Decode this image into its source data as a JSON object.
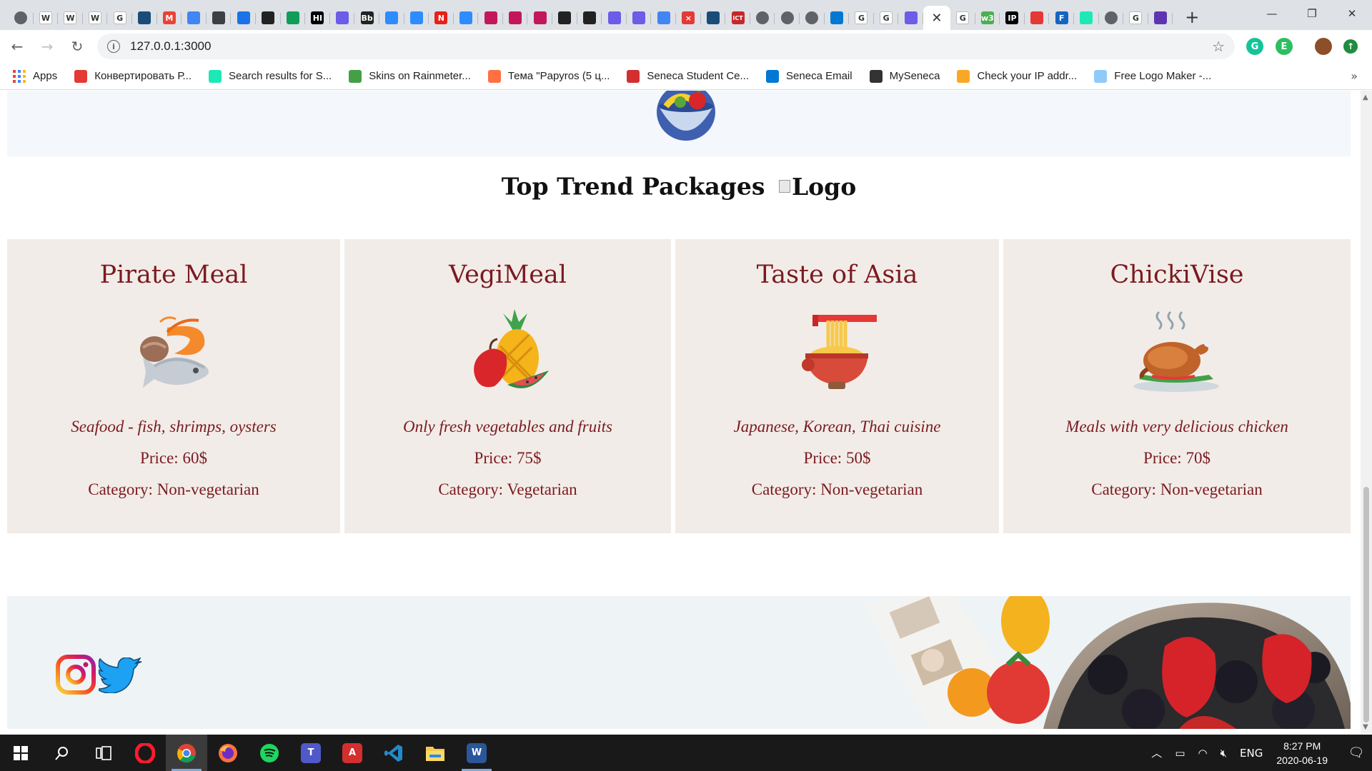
{
  "browser": {
    "tabs": [
      {
        "icon": "globe-icon",
        "color": "#5f6368",
        "glyph": ""
      },
      {
        "icon": "wikipedia-icon",
        "color": "#ffffff",
        "glyph": "W"
      },
      {
        "icon": "wikipedia-icon",
        "color": "#ffffff",
        "glyph": "W"
      },
      {
        "icon": "wikipedia-icon",
        "color": "#ffffff",
        "glyph": "W"
      },
      {
        "icon": "doc-icon",
        "color": "#ffffff",
        "glyph": "G"
      },
      {
        "icon": "bird-icon",
        "color": "#1a4c7a",
        "glyph": ""
      },
      {
        "icon": "gmail-icon",
        "color": "#ea4335",
        "glyph": "M"
      },
      {
        "icon": "translate-icon",
        "color": "#4285f4",
        "glyph": ""
      },
      {
        "icon": "image-icon",
        "color": "#3c4043",
        "glyph": ""
      },
      {
        "icon": "lines-icon",
        "color": "#1a73e8",
        "glyph": ""
      },
      {
        "icon": "qr-icon",
        "color": "#222222",
        "glyph": ""
      },
      {
        "icon": "arrow-icon",
        "color": "#0f9d58",
        "glyph": ""
      },
      {
        "icon": "hi-icon",
        "color": "#000000",
        "glyph": "HI"
      },
      {
        "icon": "wave-icon",
        "color": "#6c5ce7",
        "glyph": ""
      },
      {
        "icon": "bb-icon",
        "color": "#222222",
        "glyph": "Bb"
      },
      {
        "icon": "zoom-icon",
        "color": "#2d8cff",
        "glyph": ""
      },
      {
        "icon": "zoom-icon",
        "color": "#2d8cff",
        "glyph": ""
      },
      {
        "icon": "n-icon",
        "color": "#e62117",
        "glyph": "N"
      },
      {
        "icon": "zoom-icon",
        "color": "#2d8cff",
        "glyph": ""
      },
      {
        "icon": "play-icon",
        "color": "#c2185b",
        "glyph": ""
      },
      {
        "icon": "play-icon",
        "color": "#c2185b",
        "glyph": ""
      },
      {
        "icon": "play-icon",
        "color": "#c2185b",
        "glyph": ""
      },
      {
        "icon": "refresh-icon",
        "color": "#222222",
        "glyph": ""
      },
      {
        "icon": "github-icon",
        "color": "#222222",
        "glyph": ""
      },
      {
        "icon": "wave-icon",
        "color": "#6c5ce7",
        "glyph": ""
      },
      {
        "icon": "wave-icon",
        "color": "#6c5ce7",
        "glyph": ""
      },
      {
        "icon": "docs-icon",
        "color": "#4285f4",
        "glyph": ""
      },
      {
        "icon": "x-icon",
        "color": "#e53935",
        "glyph": "×"
      },
      {
        "icon": "bird-icon",
        "color": "#1a4c7a",
        "glyph": ""
      },
      {
        "icon": "ict-icon",
        "color": "#c62828",
        "glyph": "ICT"
      },
      {
        "icon": "globe-icon",
        "color": "#5f6368",
        "glyph": ""
      },
      {
        "icon": "globe-icon",
        "color": "#5f6368",
        "glyph": ""
      },
      {
        "icon": "globe-icon",
        "color": "#5f6368",
        "glyph": ""
      },
      {
        "icon": "outlook-icon",
        "color": "#0078d4",
        "glyph": ""
      },
      {
        "icon": "google-icon",
        "color": "#ffffff",
        "glyph": "G"
      },
      {
        "icon": "google-icon",
        "color": "#ffffff",
        "glyph": "G"
      },
      {
        "icon": "wave-icon",
        "color": "#6c5ce7",
        "glyph": ""
      },
      {
        "icon": "close-icon",
        "color": "#ffffff",
        "glyph": "✕",
        "active": true
      },
      {
        "icon": "google-icon",
        "color": "#ffffff",
        "glyph": "G"
      },
      {
        "icon": "w3-icon",
        "color": "#4caf50",
        "glyph": "w3"
      },
      {
        "icon": "ip-icon",
        "color": "#000000",
        "glyph": "IP"
      },
      {
        "icon": "opera-icon",
        "color": "#e53935",
        "glyph": ""
      },
      {
        "icon": "f-icon",
        "color": "#1565c0",
        "glyph": "F"
      },
      {
        "icon": "v-icon",
        "color": "#1de9b6",
        "glyph": ""
      },
      {
        "icon": "globe-icon",
        "color": "#5f6368",
        "glyph": ""
      },
      {
        "icon": "google-icon",
        "color": "#ffffff",
        "glyph": "G"
      },
      {
        "icon": "s-icon",
        "color": "#5e35b1",
        "glyph": ""
      }
    ],
    "new_tab": "+",
    "url": "127.0.0.1:3000",
    "bookmarks": [
      {
        "label": "Apps",
        "icon": "apps-icon",
        "color": ""
      },
      {
        "label": "Конвертировать Р...",
        "icon": "convert-icon",
        "color": "#e53935"
      },
      {
        "label": "Search results for S...",
        "icon": "v-icon",
        "color": "#1de9b6"
      },
      {
        "label": "Skins on Rainmeter...",
        "icon": "rainmeter-icon",
        "color": "#43a047"
      },
      {
        "label": "Тема \"Papyros (5 ц...",
        "icon": "theme-icon",
        "color": "#ff7043"
      },
      {
        "label": "Seneca Student Ce...",
        "icon": "seneca-icon",
        "color": "#d32f2f"
      },
      {
        "label": "Seneca Email",
        "icon": "outlook-icon",
        "color": "#0078d4"
      },
      {
        "label": "MySeneca",
        "icon": "bb-icon",
        "color": "#333333"
      },
      {
        "label": "Check your IP addr...",
        "icon": "ip-face-icon",
        "color": "#f9a825"
      },
      {
        "label": "Free Logo Maker -...",
        "icon": "logo-maker-icon",
        "color": "#90caf9"
      }
    ],
    "bookmarks_more": "»"
  },
  "page": {
    "section_title": "Top Trend Packages",
    "logo_alt": "Logo",
    "cards": [
      {
        "title": "Pirate Meal",
        "icon": "seafood-icon",
        "description": "Seafood - fish, shrimps, oysters",
        "price": "Price: 60$",
        "category": "Category: Non-vegetarian"
      },
      {
        "title": "VegiMeal",
        "icon": "fruits-icon",
        "description": "Only fresh vegetables and fruits",
        "price": "Price: 75$",
        "category": "Category: Vegetarian"
      },
      {
        "title": "Taste of Asia",
        "icon": "noodles-icon",
        "description": "Japanese, Korean, Thai cuisine",
        "price": "Price: 50$",
        "category": "Category: Non-vegetarian"
      },
      {
        "title": "ChickiVise",
        "icon": "roast-chicken-icon",
        "description": "Meals with very delicious chicken",
        "price": "Price: 70$",
        "category": "Category: Non-vegetarian"
      }
    ],
    "footer": {
      "social": [
        "instagram-icon",
        "twitter-icon"
      ]
    }
  },
  "taskbar": {
    "apps": [
      "windows-start-icon",
      "search-icon",
      "task-view-icon",
      "opera-icon",
      "chrome-icon",
      "firefox-icon",
      "spotify-icon",
      "teams-icon",
      "acrobat-icon",
      "vscode-icon",
      "file-explorer-icon",
      "word-icon"
    ],
    "language": "ENG",
    "time": "8:27 PM",
    "date": "2020-06-19"
  }
}
